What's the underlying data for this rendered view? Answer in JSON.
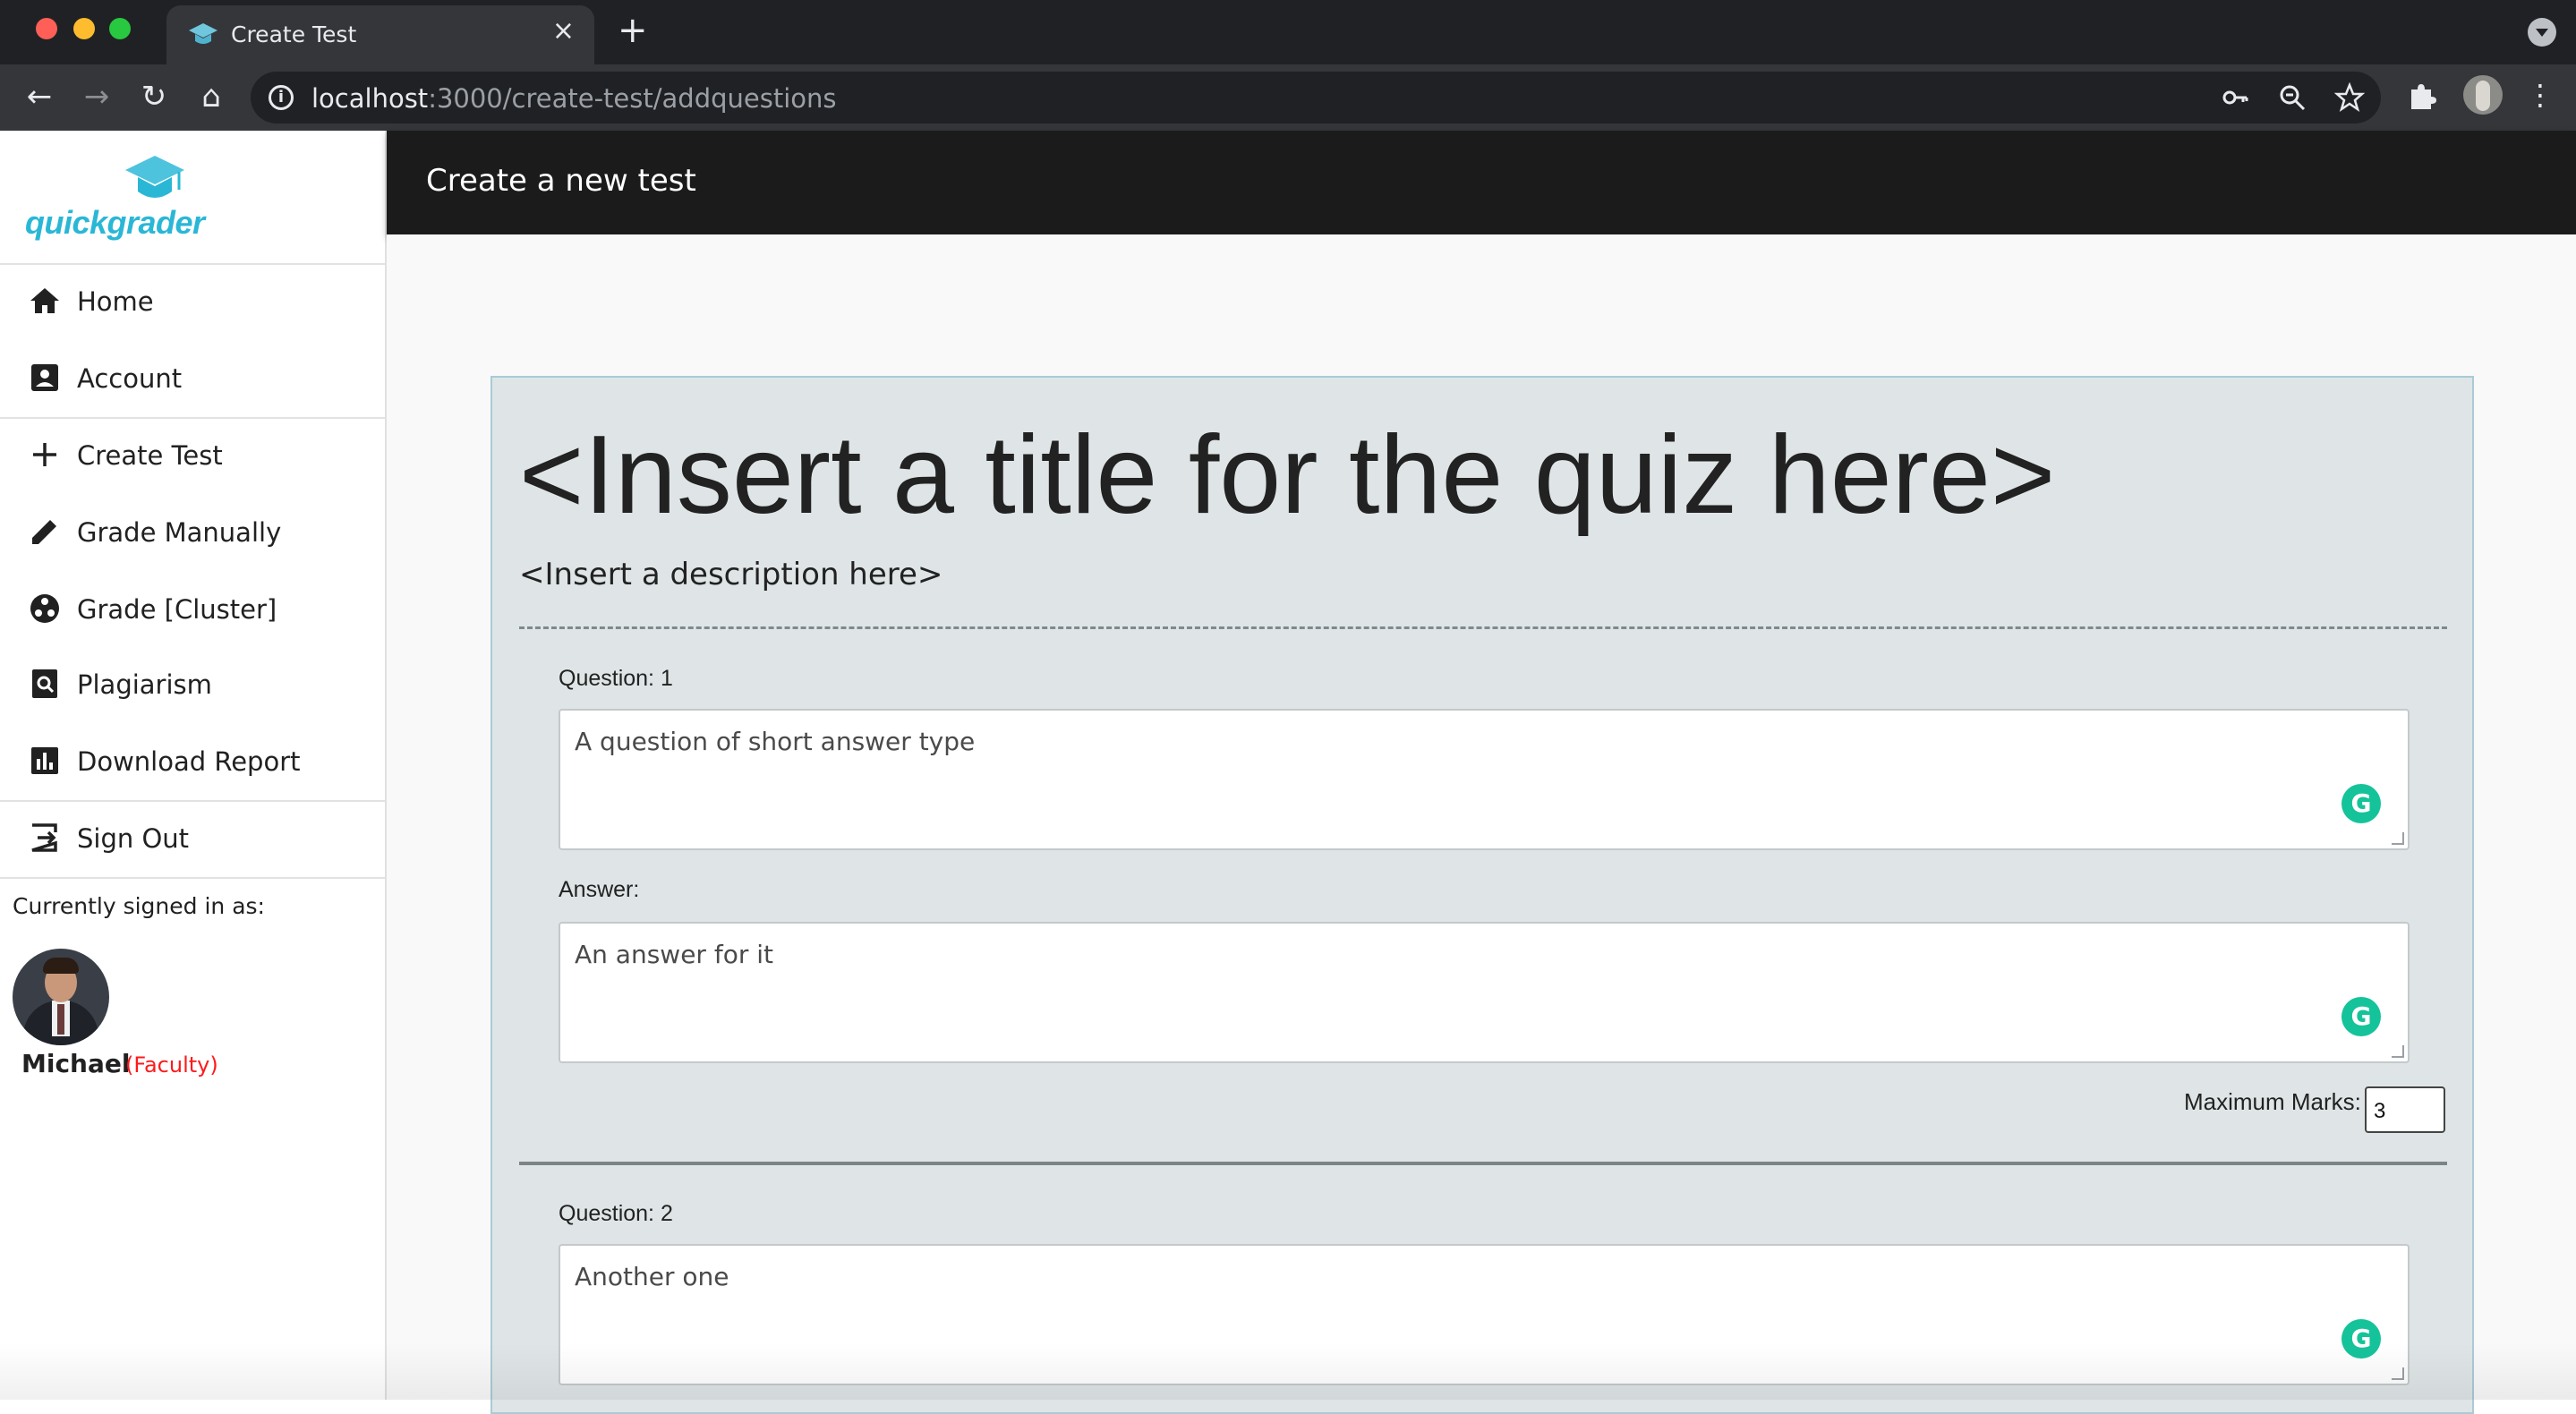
{
  "browser": {
    "tab_title": "Create Test",
    "tab_close": "×",
    "new_tab": "+",
    "url_host": "localhost",
    "url_path": ":3000/create-test/addquestions"
  },
  "sidebar": {
    "logo_text": "quickgrader",
    "items": [
      {
        "label": "Home",
        "icon": "home-icon"
      },
      {
        "label": "Account",
        "icon": "account-icon"
      },
      {
        "label": "Create Test",
        "icon": "plus-icon"
      },
      {
        "label": "Grade Manually",
        "icon": "pencil-icon"
      },
      {
        "label": "Grade [Cluster]",
        "icon": "cluster-icon"
      },
      {
        "label": "Plagiarism",
        "icon": "search-document-icon"
      },
      {
        "label": "Download Report",
        "icon": "bar-chart-icon"
      },
      {
        "label": "Sign Out",
        "icon": "sign-out-icon"
      }
    ],
    "signed_in_label": "Currently signed in as:",
    "user_name": "Michael",
    "user_role": "(Faculty)"
  },
  "header": {
    "title": "Create a new test"
  },
  "quiz": {
    "title": "<Insert a title for the quiz here>",
    "description": "<Insert a description here>",
    "questions": [
      {
        "question_label": "Question: 1",
        "question_text": "A question of short answer type",
        "answer_label": "Answer:",
        "answer_text": "An answer for it",
        "max_marks_label": "Maximum Marks:",
        "max_marks": "3"
      },
      {
        "question_label": "Question: 2",
        "question_text": "Another one"
      }
    ]
  },
  "colors": {
    "accent": "#2ab7d6",
    "appbar": "#1b1b1b",
    "quiz_bg": "#dfe5e6",
    "role": "#ff1a1a",
    "grammarly": "#15c39a"
  }
}
